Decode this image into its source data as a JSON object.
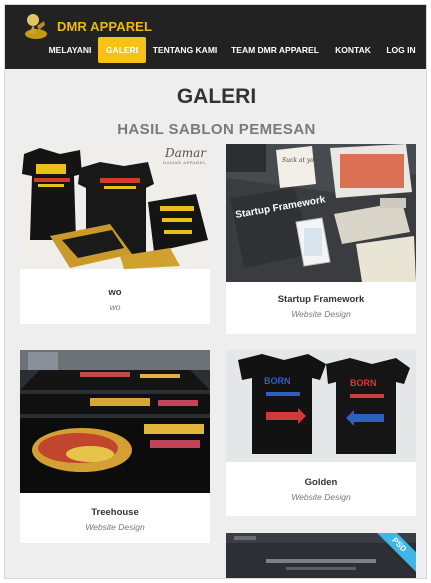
{
  "brand": {
    "name": "DMR APPAREL"
  },
  "nav": {
    "items": [
      {
        "label": "MELAYANI",
        "active": false
      },
      {
        "label": "GALERI",
        "active": true
      },
      {
        "label": "TENTANG KAMI",
        "active": false
      },
      {
        "label": "TEAM DMR APPAREL",
        "active": false
      },
      {
        "label": "KONTAK",
        "active": false
      },
      {
        "label": "LOG IN",
        "active": false
      }
    ]
  },
  "gallery": {
    "title": "GALERI",
    "subtitle": "HASIL SABLON PEMESAN",
    "items": [
      {
        "title": "wo",
        "subtitle": "wo",
        "watermark": "Damar",
        "watermark_sub": "DAMAR APPAREL"
      },
      {
        "title": "Startup Framework",
        "subtitle": "Website Design",
        "cover_text": "Startup Framework",
        "note_text": "Suck at your launch"
      },
      {
        "title": "Treehouse",
        "subtitle": "Website Design"
      },
      {
        "title": "Golden",
        "subtitle": "Website Design",
        "shirt1_text": "BORN",
        "shirt2_text": "BORN"
      },
      {
        "badge": "PSD"
      }
    ]
  },
  "colors": {
    "accent": "#f7c213",
    "nav_bg": "#222222",
    "brand": "#f0b90b",
    "badge": "#3fb6e8"
  }
}
